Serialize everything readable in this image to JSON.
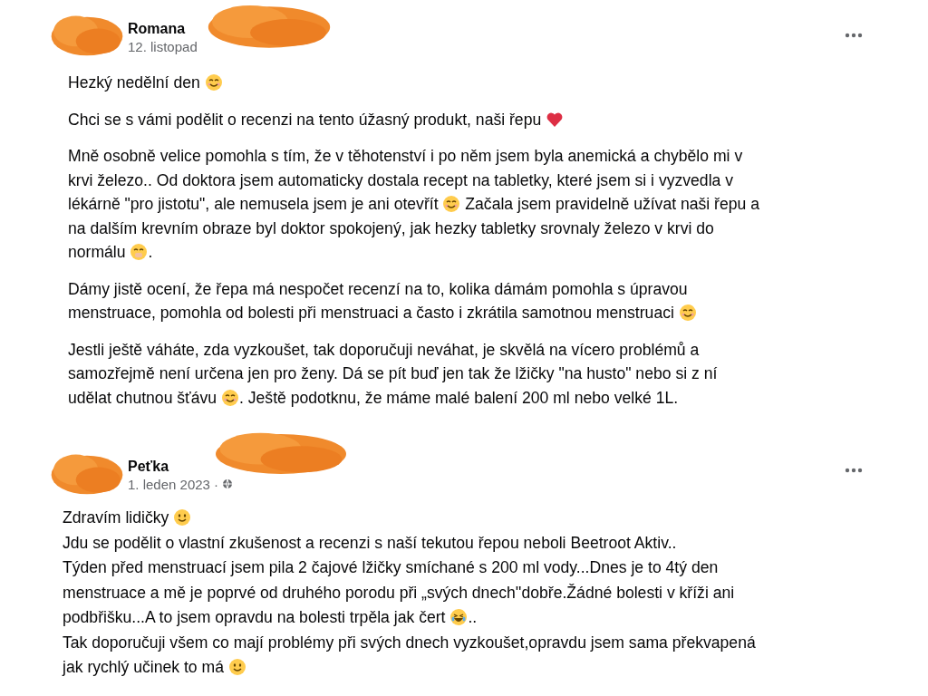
{
  "posts": [
    {
      "author": "Romana",
      "date": "12. listopad",
      "paragraphs": [
        [
          [
            {
              "kind": "text",
              "text": "Hezký nedělní den "
            },
            {
              "kind": "blush"
            }
          ]
        ],
        [
          [
            {
              "kind": "text",
              "text": "Chci se s vámi podělit o recenzi na tento úžasný produkt, naši řepu "
            },
            {
              "kind": "heart"
            }
          ]
        ],
        [
          [
            {
              "kind": "text",
              "text": "Mně osobně velice pomohla s tím, že v těhotenství i po něm jsem byla anemická a chybělo mi v"
            }
          ],
          [
            {
              "kind": "text",
              "text": "krvi železo.. Od doktora jsem automaticky dostala recept na tabletky, které jsem si i vyzvedla v"
            }
          ],
          [
            {
              "kind": "text",
              "text": "lékárně \"pro jistotu\", ale nemusela jsem je ani otevřít "
            },
            {
              "kind": "blush"
            },
            {
              "kind": "text",
              "text": " Začala jsem pravidelně užívat naši řepu a"
            }
          ],
          [
            {
              "kind": "text",
              "text": "na dalším krevním obraze byl doktor spokojený, jak hezky tabletky srovnaly železo v krvi do"
            }
          ],
          [
            {
              "kind": "text",
              "text": "normálu "
            },
            {
              "kind": "hush"
            },
            {
              "kind": "text",
              "text": "."
            }
          ]
        ],
        [
          [
            {
              "kind": "text",
              "text": "Dámy jistě ocení, že řepa má nespočet recenzí na to, kolika dámám pomohla s úpravou"
            }
          ],
          [
            {
              "kind": "text",
              "text": "menstruace, pomohla od bolesti při menstruaci a často i zkrátila samotnou menstruaci "
            },
            {
              "kind": "blush"
            }
          ]
        ],
        [
          [
            {
              "kind": "text",
              "text": "Jestli ještě váháte, zda vyzkoušet, tak doporučuji neváhat, je skvělá na vícero problémů a"
            }
          ],
          [
            {
              "kind": "text",
              "text": "samozřejmě není určena jen pro ženy. Dá se pít buď jen tak že lžičky \"na husto\" nebo si z ní"
            }
          ],
          [
            {
              "kind": "text",
              "text": "udělat chutnou šťávu "
            },
            {
              "kind": "blush"
            },
            {
              "kind": "text",
              "text": ". Ještě podotknu, že máme malé balení 200 ml nebo velké 1L."
            }
          ]
        ]
      ]
    },
    {
      "author": "Peťka",
      "date": "1. leden 2023 ·",
      "lines": [
        [
          [
            {
              "kind": "text",
              "text": "Zdravím lidičky "
            },
            {
              "kind": "smile"
            }
          ]
        ],
        [
          [
            {
              "kind": "text",
              "text": "Jdu se podělit o vlastní zkušenost a recenzi s naší tekutou řepou neboli Beetroot Aktiv.."
            }
          ]
        ],
        [
          [
            {
              "kind": "text",
              "text": "Týden před menstruací jsem pila 2 čajové lžičky smíchané s 200 ml vody...Dnes je to 4tý den"
            }
          ],
          [
            {
              "kind": "text",
              "text": "menstruace a mě je poprvé od druhého porodu při „svých dnech''dobře.Žádné bolesti v kříži ani"
            }
          ],
          [
            {
              "kind": "text",
              "text": "podbřišku...A to jsem opravdu na bolesti trpěla jak čert "
            },
            {
              "kind": "laugh"
            },
            {
              "kind": "text",
              "text": ".."
            }
          ]
        ],
        [
          [
            {
              "kind": "text",
              "text": "Tak doporučuji všem co mají problémy při svých dnech vyzkoušet,opravdu jsem sama překvapená"
            }
          ],
          [
            {
              "kind": "text",
              "text": "jak rychlý učinek to má "
            },
            {
              "kind": "smile"
            }
          ]
        ]
      ]
    }
  ]
}
